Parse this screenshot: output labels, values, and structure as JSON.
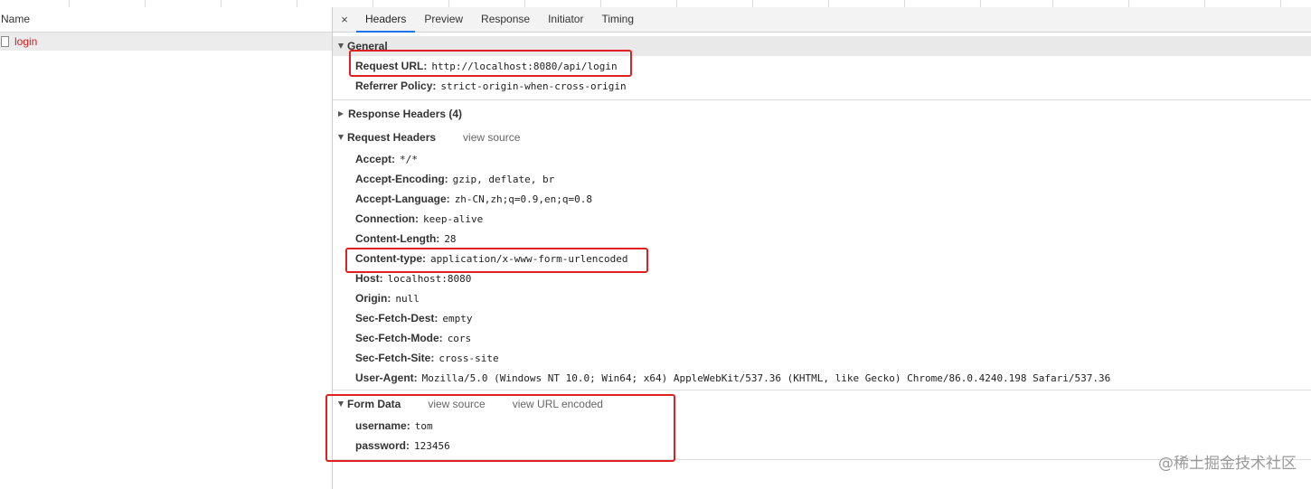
{
  "left": {
    "column_header": "Name",
    "requests": [
      {
        "name": "login"
      }
    ]
  },
  "tabs": {
    "close": "×",
    "items": [
      "Headers",
      "Preview",
      "Response",
      "Initiator",
      "Timing"
    ],
    "active": "Headers"
  },
  "general": {
    "title": "General",
    "rows": [
      {
        "key": "Request URL:",
        "value": "http://localhost:8080/api/login"
      },
      {
        "key": "Referrer Policy:",
        "value": "strict-origin-when-cross-origin"
      }
    ]
  },
  "response_headers": {
    "title": "Response Headers (4)"
  },
  "request_headers": {
    "title": "Request Headers",
    "view_source": "view source",
    "rows": [
      {
        "key": "Accept:",
        "value": "*/*"
      },
      {
        "key": "Accept-Encoding:",
        "value": "gzip, deflate, br"
      },
      {
        "key": "Accept-Language:",
        "value": "zh-CN,zh;q=0.9,en;q=0.8"
      },
      {
        "key": "Connection:",
        "value": "keep-alive"
      },
      {
        "key": "Content-Length:",
        "value": "28"
      },
      {
        "key": "Content-type:",
        "value": "application/x-www-form-urlencoded"
      },
      {
        "key": "Host:",
        "value": "localhost:8080"
      },
      {
        "key": "Origin:",
        "value": "null"
      },
      {
        "key": "Sec-Fetch-Dest:",
        "value": "empty"
      },
      {
        "key": "Sec-Fetch-Mode:",
        "value": "cors"
      },
      {
        "key": "Sec-Fetch-Site:",
        "value": "cross-site"
      },
      {
        "key": "User-Agent:",
        "value": "Mozilla/5.0 (Windows NT 10.0; Win64; x64) AppleWebKit/537.36 (KHTML, like Gecko) Chrome/86.0.4240.198 Safari/537.36"
      }
    ]
  },
  "form_data": {
    "title": "Form Data",
    "view_source": "view source",
    "view_url_encoded": "view URL encoded",
    "rows": [
      {
        "key": "username:",
        "value": "tom"
      },
      {
        "key": "password:",
        "value": "123456"
      }
    ]
  },
  "watermark": "@稀土掘金技术社区",
  "colors": {
    "highlight": "#e02020",
    "request_name": "#d81b1b",
    "active_tab_underline": "#1a73e8"
  }
}
